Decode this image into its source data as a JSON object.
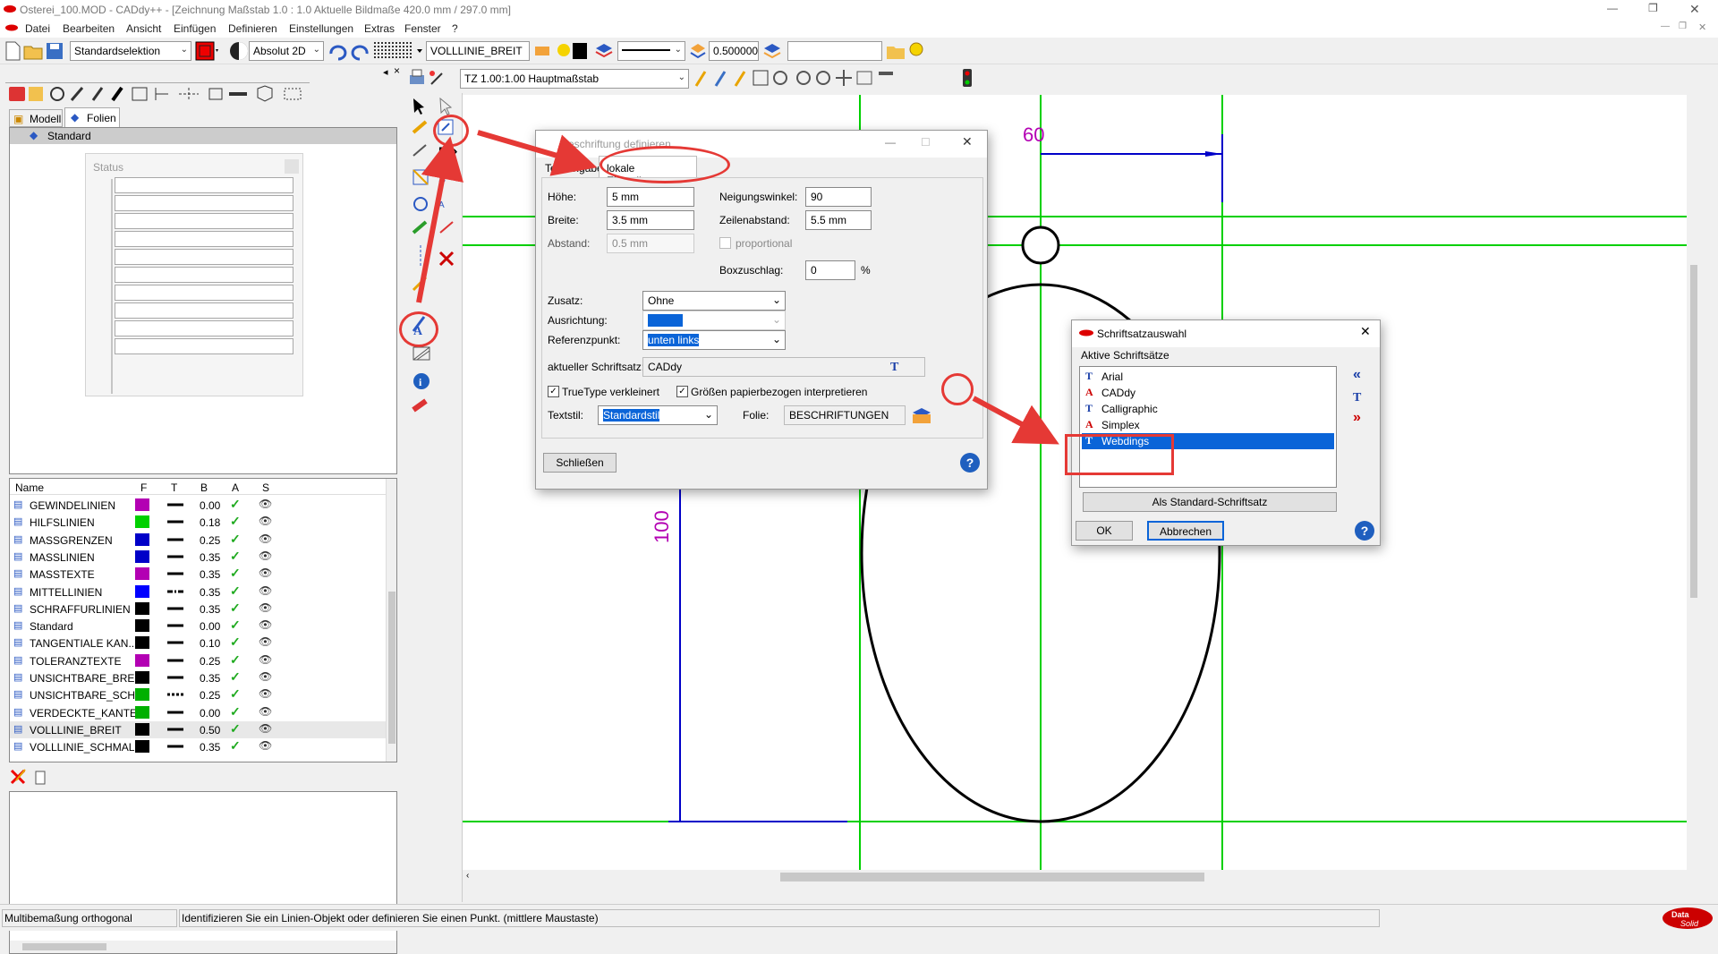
{
  "window": {
    "title": "Osterei_100.MOD  -  CADdy++ - [Zeichnung   Maßstab 1.0 : 1.0   Aktuelle Bildmaße 420.0 mm / 297.0 mm]"
  },
  "menu": [
    "Datei",
    "Bearbeiten",
    "Ansicht",
    "Einfügen",
    "Definieren",
    "Einstellungen",
    "Extras",
    "Fenster",
    "?"
  ],
  "toolbar": {
    "selection": "Standardselektion",
    "mode": "Absolut 2D",
    "layer": "VOLLLINIE_BREIT",
    "linewidth": "0.500000",
    "scale": "TZ 1.00:1.00 Hauptmaßstab"
  },
  "left": {
    "tabs": [
      "Modell",
      "Folien"
    ],
    "tree_root": "Standard",
    "status_title": "Status",
    "layer_headers": [
      "Name",
      "F",
      "T",
      "B",
      "A",
      "S"
    ],
    "layers": [
      {
        "name": "GEWINDELINIEN",
        "color": "#b300b3",
        "width": "0.00",
        "style": "solid"
      },
      {
        "name": "HILFSLINIEN",
        "color": "#00d000",
        "width": "0.18",
        "style": "solid"
      },
      {
        "name": "MASSGRENZEN",
        "color": "#0000c8",
        "width": "0.25",
        "style": "solid"
      },
      {
        "name": "MASSLINIEN",
        "color": "#0000c8",
        "width": "0.35",
        "style": "solid"
      },
      {
        "name": "MASSTEXTE",
        "color": "#b300b3",
        "width": "0.35",
        "style": "solid"
      },
      {
        "name": "MITTELLINIEN",
        "color": "#0000ff",
        "width": "0.35",
        "style": "dashdot"
      },
      {
        "name": "SCHRAFFURLINIEN",
        "color": "#000000",
        "width": "0.35",
        "style": "solid"
      },
      {
        "name": "Standard",
        "color": "#000000",
        "width": "0.00",
        "style": "solid"
      },
      {
        "name": "TANGENTIALE KAN...",
        "color": "#000000",
        "width": "0.10",
        "style": "solid"
      },
      {
        "name": "TOLERANZTEXTE",
        "color": "#b300b3",
        "width": "0.25",
        "style": "solid"
      },
      {
        "name": "UNSICHTBARE_BREIT",
        "color": "#000000",
        "width": "0.35",
        "style": "solid"
      },
      {
        "name": "UNSICHTBARE_SCH...",
        "color": "#00b000",
        "width": "0.25",
        "style": "dashed"
      },
      {
        "name": "VERDECKTE_KANTE...",
        "color": "#00b000",
        "width": "0.00",
        "style": "solid"
      },
      {
        "name": "VOLLLINIE_BREIT",
        "color": "#000000",
        "width": "0.50",
        "style": "solid"
      },
      {
        "name": "VOLLLINIE_SCHMAL",
        "color": "#000000",
        "width": "0.35",
        "style": "solid"
      }
    ]
  },
  "drawing": {
    "dim_horizontal": "60",
    "dim_vertical": "100"
  },
  "dialog1": {
    "title": "Beschriftung definieren",
    "tab1": "Texteingabe",
    "tab2": "lokale Einstellungen",
    "hoehe_label": "Höhe:",
    "hoehe": "5 mm",
    "breite_label": "Breite:",
    "breite": "3.5 mm",
    "abstand_label": "Abstand:",
    "abstand": "0.5 mm",
    "neigung_label": "Neigungswinkel:",
    "neigung": "90",
    "zeilen_label": "Zeilenabstand:",
    "zeilen": "5.5 mm",
    "proportional": "proportional",
    "box_label": "Boxzuschlag:",
    "box": "0",
    "percent": "%",
    "zusatz_label": "Zusatz:",
    "zusatz": "Ohne",
    "ausrichtung_label": "Ausrichtung:",
    "ausrichtung": "Normal",
    "referenz_label": "Referenzpunkt:",
    "referenz": "unten links",
    "schriftsatz_label": "aktueller Schriftsatz:",
    "schriftsatz": "CADdy",
    "truetype": "TrueType verkleinert",
    "groessen": "Größen papierbezogen interpretieren",
    "textstil_label": "Textstil:",
    "textstil": "Standardstil",
    "folie_label": "Folie:",
    "folie": "BESCHRIFTUNGEN",
    "close": "Schließen"
  },
  "dialog2": {
    "title": "Schriftsatzauswahl",
    "group": "Aktive Schriftsätze",
    "fonts": [
      "Arial",
      "CADdy",
      "Calligraphic",
      "Simplex",
      "Webdings"
    ],
    "selected": "Webdings",
    "standard": "Als Standard-Schriftsatz",
    "ok": "OK",
    "cancel": "Abbrechen"
  },
  "status": {
    "left": "Multibemaßung orthogonal",
    "right": "Identifizieren Sie ein Linien-Objekt oder definieren Sie einen Punkt.  (mittlere Maustaste)"
  },
  "colors": {
    "grid": "#00d000",
    "dim": "#0000c8",
    "text_dim": "#b300b3",
    "annotation": "#e53935"
  }
}
